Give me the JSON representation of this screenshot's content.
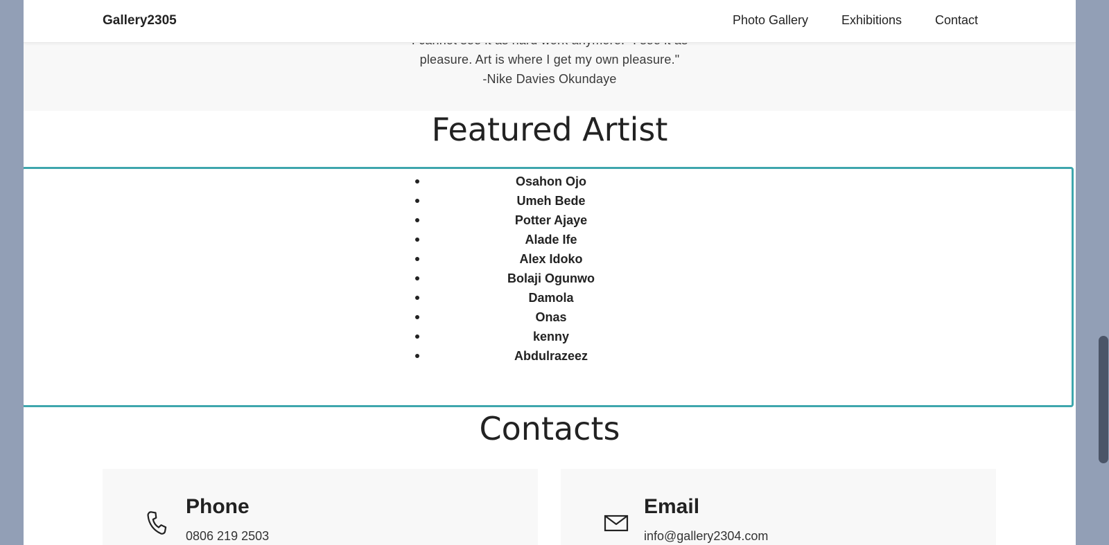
{
  "navbar": {
    "brand": "Gallery2305",
    "links": [
      "Photo Gallery",
      "Exhibitions",
      "Contact"
    ]
  },
  "quote": {
    "line1": "I cannot see it as hard work anymore. \"I see it as",
    "line2": "pleasure. Art is where I get my own pleasure.\"",
    "author": "-Nike Davies Okundaye"
  },
  "featured": {
    "heading": "Featured Artist",
    "artists": [
      "Osahon Ojo",
      "Umeh Bede",
      "Potter Ajaye",
      "Alade Ife",
      "Alex Idoko",
      "Bolaji Ogunwo",
      "Damola",
      "Onas",
      "kenny",
      "Abdulrazeez"
    ]
  },
  "contacts": {
    "heading": "Contacts",
    "phone": {
      "title": "Phone",
      "value": "0806 219 2503",
      "icon": "phone-icon"
    },
    "email": {
      "title": "Email",
      "value": "info@gallery2304.com",
      "icon": "mail-icon"
    }
  },
  "colors": {
    "highlight_border": "#3ea6ad",
    "backdrop": "#929fb6",
    "band": "#f8f8f8",
    "text": "#222222"
  }
}
